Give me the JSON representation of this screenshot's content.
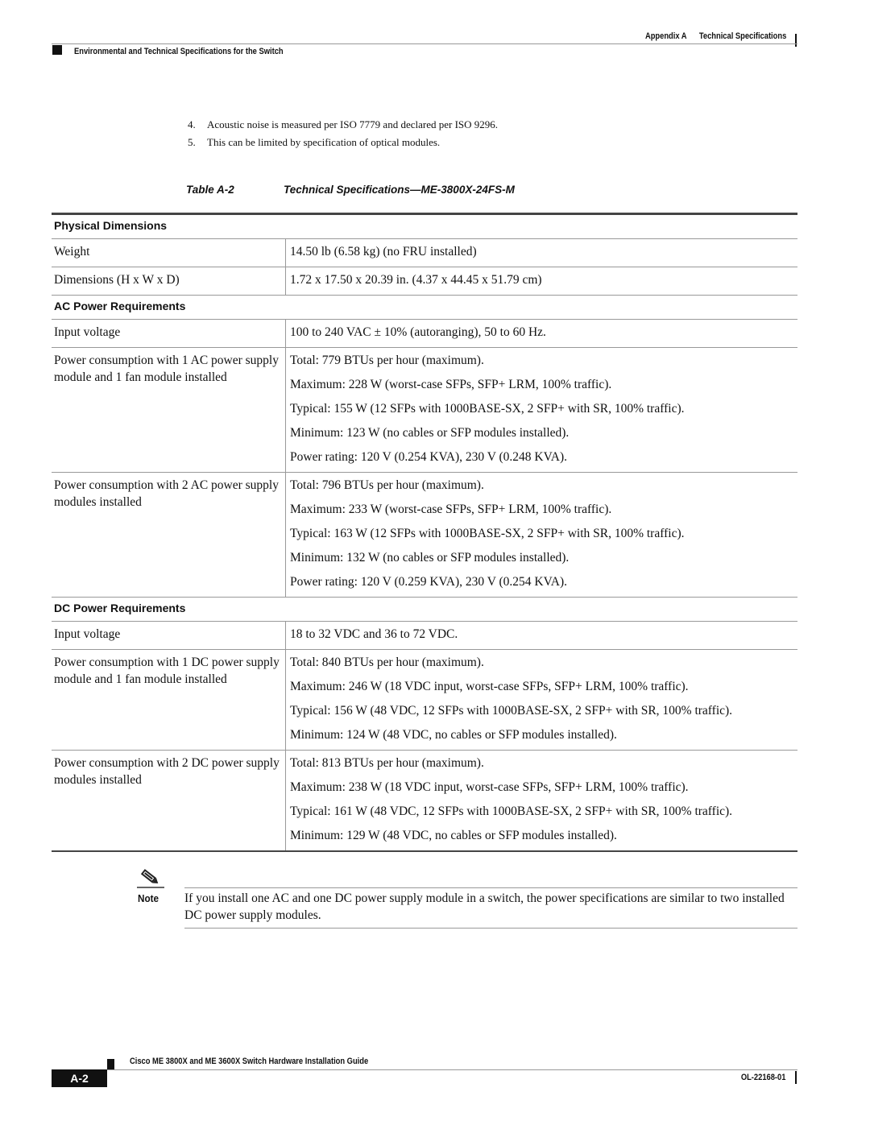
{
  "header": {
    "appendix": "Appendix A",
    "chapter_title": "Technical Specifications",
    "section_title": "Environmental and Technical Specifications for the Switch"
  },
  "footnotes": [
    {
      "num": "4.",
      "text": "Acoustic noise is measured per ISO 7779 and declared per ISO 9296."
    },
    {
      "num": "5.",
      "text": "This can be limited by specification of optical modules."
    }
  ],
  "table": {
    "caption_num": "Table A-2",
    "caption_title": "Technical Specifications—ME-3800X-24FS-M",
    "sections": [
      {
        "title": "Physical Dimensions",
        "rows": [
          {
            "label": "Weight",
            "values": [
              "14.50 lb (6.58 kg) (no FRU installed)"
            ]
          },
          {
            "label": "Dimensions (H x W x D)",
            "values": [
              "1.72 x 17.50 x 20.39 in. (4.37 x 44.45 x 51.79 cm)"
            ]
          }
        ]
      },
      {
        "title": "AC Power Requirements",
        "rows": [
          {
            "label": "Input voltage",
            "values": [
              "100 to 240 VAC ± 10% (autoranging), 50 to 60 Hz."
            ]
          },
          {
            "label": "Power consumption with 1 AC power supply module and 1 fan module installed",
            "values": [
              "Total: 779 BTUs per hour (maximum).",
              "Maximum: 228 W (worst-case SFPs, SFP+ LRM, 100% traffic).",
              "Typical: 155 W (12 SFPs with 1000BASE-SX, 2 SFP+ with SR, 100% traffic).",
              "Minimum: 123 W (no cables or SFP modules installed).",
              "Power rating: 120 V (0.254 KVA), 230 V (0.248 KVA)."
            ]
          },
          {
            "label": "Power consumption with 2 AC power supply modules installed",
            "values": [
              "Total: 796 BTUs per hour (maximum).",
              "Maximum: 233 W (worst-case SFPs, SFP+ LRM, 100% traffic).",
              "Typical: 163 W (12 SFPs with 1000BASE-SX, 2 SFP+ with SR, 100% traffic).",
              "Minimum: 132 W (no cables or SFP modules installed).",
              "Power rating: 120 V (0.259 KVA), 230 V (0.254 KVA)."
            ]
          }
        ]
      },
      {
        "title": "DC Power Requirements",
        "rows": [
          {
            "label": "Input voltage",
            "values": [
              "18 to 32 VDC and 36 to 72 VDC."
            ]
          },
          {
            "label": "Power consumption with 1 DC power supply module and 1 fan module installed",
            "values": [
              "Total: 840 BTUs per hour (maximum).",
              "Maximum: 246 W (18 VDC input, worst-case SFPs, SFP+ LRM, 100% traffic).",
              "Typical: 156 W (48 VDC, 12 SFPs with 1000BASE-SX, 2 SFP+ with SR, 100% traffic).",
              "Minimum: 124 W (48 VDC, no cables or SFP modules installed)."
            ]
          },
          {
            "label": "Power consumption with 2 DC power supply modules installed",
            "values": [
              "Total: 813 BTUs per hour (maximum).",
              "Maximum: 238 W (18 VDC input, worst-case SFPs, SFP+ LRM, 100% traffic).",
              "Typical: 161 W (48 VDC, 12 SFPs with 1000BASE-SX, 2 SFP+ with SR, 100% traffic).",
              "Minimum: 129 W (48 VDC, no cables or SFP modules installed)."
            ]
          }
        ]
      }
    ]
  },
  "note": {
    "icon": "pencil-icon",
    "label": "Note",
    "text": "If you install one AC and one DC power supply module in a switch, the power specifications are similar to two installed DC power supply modules."
  },
  "footer": {
    "page_number": "A-2",
    "book_title": "Cisco ME 3800X and ME 3600X Switch Hardware Installation Guide",
    "doc_number": "OL-22168-01"
  }
}
